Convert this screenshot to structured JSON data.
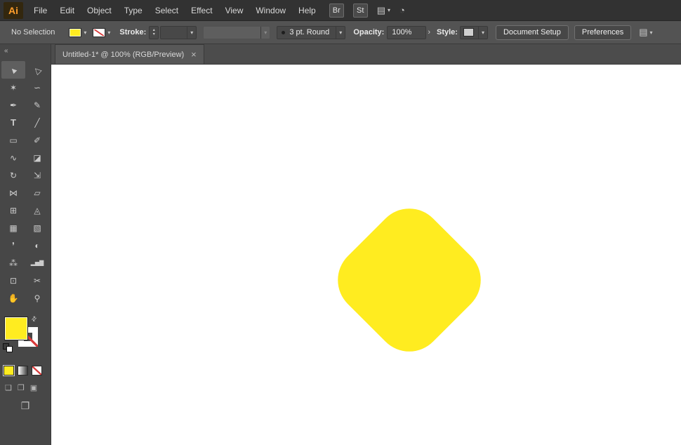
{
  "app": {
    "logo": "Ai"
  },
  "menubar": {
    "items": [
      "File",
      "Edit",
      "Object",
      "Type",
      "Select",
      "Effect",
      "View",
      "Window",
      "Help"
    ],
    "bridge": "Br",
    "stock": "St"
  },
  "control_bar": {
    "no_selection": "No Selection",
    "stroke_label": "Stroke:",
    "brush_value": "3 pt. Round",
    "opacity_label": "Opacity:",
    "opacity_value": "100%",
    "style_label": "Style:",
    "document_setup": "Document Setup",
    "preferences": "Preferences"
  },
  "tab": {
    "title": "Untitled-1* @ 100% (RGB/Preview)"
  },
  "tools": [
    {
      "name": "selection",
      "glyph": "▲"
    },
    {
      "name": "direct-selection",
      "glyph": "△"
    },
    {
      "name": "magic-wand",
      "glyph": "✶"
    },
    {
      "name": "lasso",
      "glyph": "∽"
    },
    {
      "name": "pen",
      "glyph": "✒"
    },
    {
      "name": "curvature",
      "glyph": "✎"
    },
    {
      "name": "type",
      "glyph": "T"
    },
    {
      "name": "line-segment",
      "glyph": "╱"
    },
    {
      "name": "rectangle",
      "glyph": "▭"
    },
    {
      "name": "paintbrush",
      "glyph": "✐"
    },
    {
      "name": "shaper",
      "glyph": "∿"
    },
    {
      "name": "eraser",
      "glyph": "◪"
    },
    {
      "name": "rotate",
      "glyph": "↻"
    },
    {
      "name": "scale",
      "glyph": "⇲"
    },
    {
      "name": "width",
      "glyph": "⋈"
    },
    {
      "name": "free-transform",
      "glyph": "▱"
    },
    {
      "name": "shape-builder",
      "glyph": "⊞"
    },
    {
      "name": "perspective-grid",
      "glyph": "◬"
    },
    {
      "name": "mesh",
      "glyph": "▦"
    },
    {
      "name": "gradient",
      "glyph": "▧"
    },
    {
      "name": "eyedropper",
      "glyph": "❜"
    },
    {
      "name": "blend",
      "glyph": "◐"
    },
    {
      "name": "symbol-sprayer",
      "glyph": "⁂"
    },
    {
      "name": "column-graph",
      "glyph": "▂▅▇"
    },
    {
      "name": "artboard",
      "glyph": "⊡"
    },
    {
      "name": "slice",
      "glyph": "✂"
    },
    {
      "name": "hand",
      "glyph": "✋"
    },
    {
      "name": "zoom",
      "glyph": "⚲"
    }
  ],
  "icons": {
    "chevron_down": "▾",
    "chevron_right": "›",
    "stepper_up": "▴",
    "stepper_down": "▾",
    "close": "×",
    "collapse_tools": "«",
    "arrange_documents": "▤",
    "gpu_meter": "◔",
    "workspace": "▤",
    "swap": "⇄",
    "draw_normal": "❑",
    "draw_behind": "❒",
    "draw_inside": "▣",
    "screen_mode": "❐"
  },
  "colors": {
    "fill": "#FFEC20",
    "stroke": "none",
    "slash_red": "#D83A3A",
    "logo_orange": "#FF9E2C"
  },
  "canvas": {
    "shape": {
      "type": "rounded-diamond",
      "fill": "#FFEC20"
    }
  }
}
